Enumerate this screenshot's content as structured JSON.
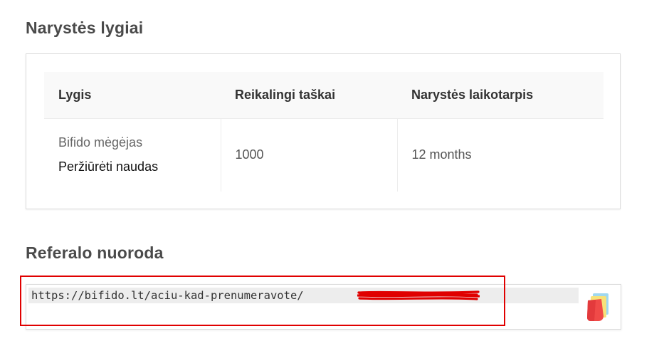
{
  "levels_section": {
    "title": "Narystės lygiai",
    "table": {
      "headers": [
        "Lygis",
        "Reikalingi taškai",
        "Narystės laikotarpis"
      ],
      "rows": [
        {
          "level_name": "Bifido mėgėjas",
          "benefits_link": "Peržiūrėti naudas",
          "points": "1000",
          "period": "12 months"
        }
      ]
    }
  },
  "referral_section": {
    "title": "Referalo nuoroda",
    "link_visible": "https://bifido.lt/aciu-kad-prenumeravote/",
    "link_suffix_redacted": true,
    "copy_icon": "copy-icon"
  },
  "colors": {
    "highlight_frame": "#e00000",
    "redaction": "#e00000",
    "input_background": "#ededed"
  }
}
